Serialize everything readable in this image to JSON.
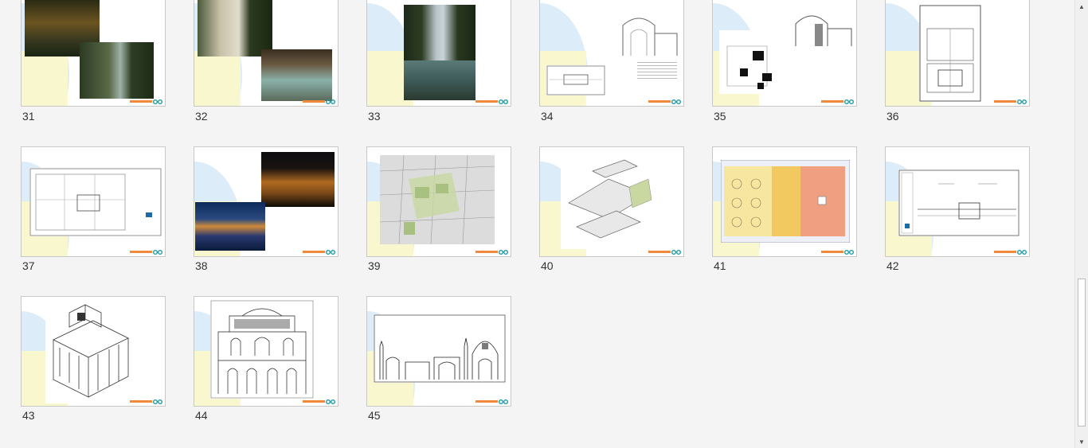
{
  "slides": [
    {
      "number": "31",
      "content": "garden-photos"
    },
    {
      "number": "32",
      "content": "pool-photos"
    },
    {
      "number": "33",
      "content": "garden-pool-photo"
    },
    {
      "number": "34",
      "content": "section-drawing"
    },
    {
      "number": "35",
      "content": "section-plan-drawing"
    },
    {
      "number": "36",
      "content": "plan-drawing"
    },
    {
      "number": "37",
      "content": "floor-plan-drawing"
    },
    {
      "number": "38",
      "content": "palace-night-photos"
    },
    {
      "number": "39",
      "content": "site-map"
    },
    {
      "number": "40",
      "content": "axonometric-drawing"
    },
    {
      "number": "41",
      "content": "colored-plan"
    },
    {
      "number": "42",
      "content": "elevation-sheet"
    },
    {
      "number": "43",
      "content": "isometric-drawing"
    },
    {
      "number": "44",
      "content": "facade-drawing"
    },
    {
      "number": "45",
      "content": "mosque-section-drawing"
    }
  ],
  "colors": {
    "footer_accent": "#f08a3a",
    "logo_teal": "#1a9aa0",
    "background": "#f4f4f4",
    "arc": "#dcecf8",
    "yellow_band": "#fbf8c8"
  },
  "scrollbar": {
    "up_icon": "triangle-up",
    "down_icon": "triangle-down"
  }
}
